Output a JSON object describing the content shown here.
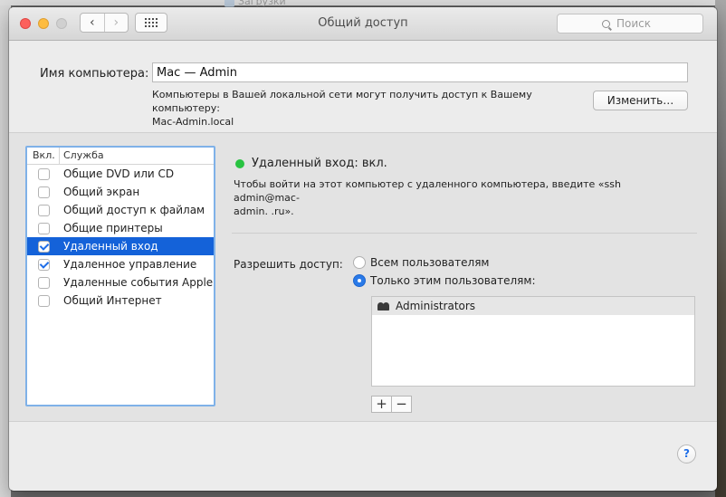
{
  "background": {
    "behind_window_label": "Загрузки"
  },
  "window": {
    "title": "Общий доступ",
    "nav": {
      "back": "‹",
      "forward": "›"
    },
    "search": {
      "placeholder": "Поиск"
    }
  },
  "computer": {
    "name_label": "Имя компьютера:",
    "name_value": "Mac — Admin",
    "note_line1": "Компьютеры в Вашей локальной сети могут получить доступ к Вашему компьютеру:",
    "note_line2": "Mac-Admin.local",
    "change_button": "Изменить…"
  },
  "services": {
    "header_on": "Вкл.",
    "header_service": "Служба",
    "items": [
      {
        "label": "Общие DVD или CD",
        "checked": false,
        "selected": false
      },
      {
        "label": "Общий экран",
        "checked": false,
        "selected": false
      },
      {
        "label": "Общий доступ к файлам",
        "checked": false,
        "selected": false
      },
      {
        "label": "Общие принтеры",
        "checked": false,
        "selected": false
      },
      {
        "label": "Удаленный вход",
        "checked": true,
        "selected": true
      },
      {
        "label": "Удаленное управление",
        "checked": true,
        "selected": false
      },
      {
        "label": "Удаленные события Apple",
        "checked": false,
        "selected": false
      },
      {
        "label": "Общий Интернет",
        "checked": false,
        "selected": false
      }
    ]
  },
  "detail": {
    "status_text": "Удаленный вход: вкл.",
    "status_color": "#28c341",
    "note_line1": "Чтобы войти на этот компьютер с удаленного компьютера, введите «ssh admin@mac-",
    "note_line2": "admin.             .ru».",
    "allow_label": "Разрешить доступ:",
    "radio_all": "Всем пользователям",
    "radio_only": "Только этим пользователям:",
    "radio_selected": "only",
    "users": [
      {
        "name": "Administrators",
        "icon": "group-icon"
      }
    ],
    "add_button": "+",
    "remove_button": "−"
  },
  "help_button": "?",
  "colors": {
    "selection": "#1462d9",
    "list_focus_border": "#7fb1e8",
    "close": "#fc605c",
    "minimize": "#fdbc40"
  }
}
